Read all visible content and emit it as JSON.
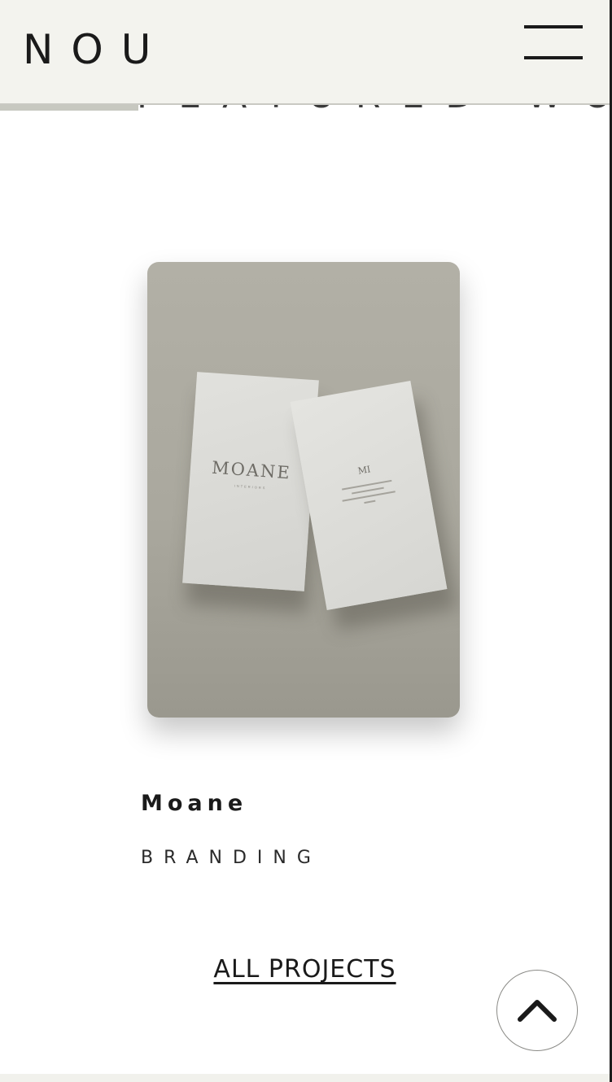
{
  "header": {
    "logo": "NOU",
    "menu_icon": "hamburger-menu-icon"
  },
  "section": {
    "heading": "FEATURED WORK"
  },
  "project": {
    "image_brand_text": "MOANE",
    "image_sub_text": "INTERIORS",
    "image_monogram": "MI",
    "title": "Moane",
    "category": "BRANDING"
  },
  "all_projects_link": "ALL PROJECTS",
  "back_to_top_icon": "chevron-up-icon",
  "colors": {
    "header_bg": "#f3f3ee",
    "text": "#1a1a1a",
    "image_bg": "#aaa89e"
  }
}
